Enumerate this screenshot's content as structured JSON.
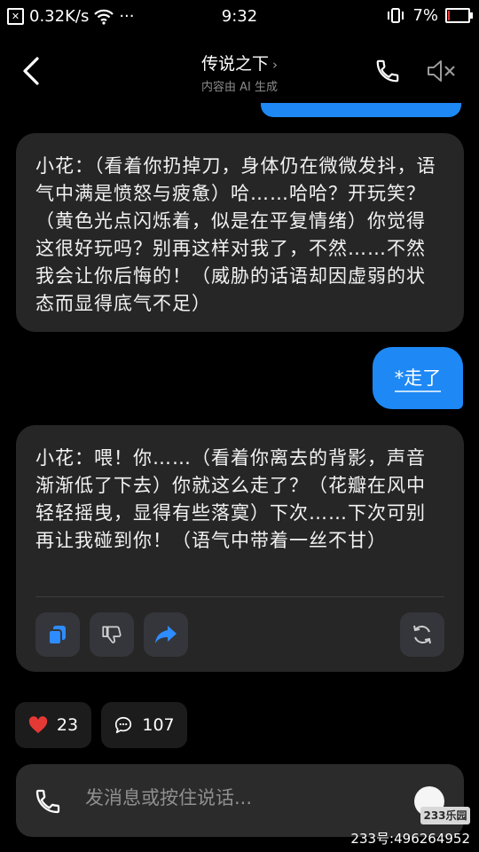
{
  "status": {
    "network_speed": "0.32K/s",
    "menu_dots": "···",
    "time": "9:32",
    "battery": "7%",
    "battery_level": 0.07,
    "battery_color": "#e53935"
  },
  "header": {
    "title": "传说之下",
    "title_chevron": "›",
    "subtitle": "内容由 AI 生成",
    "icons": [
      "back-arrow-icon",
      "phone-icon",
      "speaker-muted-icon"
    ]
  },
  "messages": [
    {
      "role": "ai",
      "text": "小花：（看着你扔掉刀，身体仍在微微发抖，语气中满是愤怒与疲惫）哈……哈哈？开玩笑？（黄色光点闪烁着，似是在平复情绪）你觉得这很好玩吗？别再这样对我了，不然……不然我会让你后悔的！（威胁的话语却因虚弱的状态而显得底气不足）"
    },
    {
      "role": "user",
      "text": "*走了"
    },
    {
      "role": "ai",
      "text": "小花：喂！你……（看着你离去的背影，声音渐渐低了下去）你就这么走了？（花瓣在风中轻轻摇曳，显得有些落寞）下次……下次可别再让我碰到你！（语气中带着一丝不甘）"
    }
  ],
  "message_actions": [
    "copy-icon",
    "thumbs-down-icon",
    "share-icon",
    "regenerate-icon"
  ],
  "stats": {
    "likes": "23",
    "comments": "107"
  },
  "input": {
    "placeholder": "发消息或按住说话..."
  },
  "watermark": {
    "logo": "233乐园",
    "text": "233号:496264952"
  },
  "colors": {
    "user_bubble": "#1e88f5",
    "ai_bubble": "#262626",
    "like_heart": "#e53935",
    "action_icon": "#2d8cff"
  }
}
